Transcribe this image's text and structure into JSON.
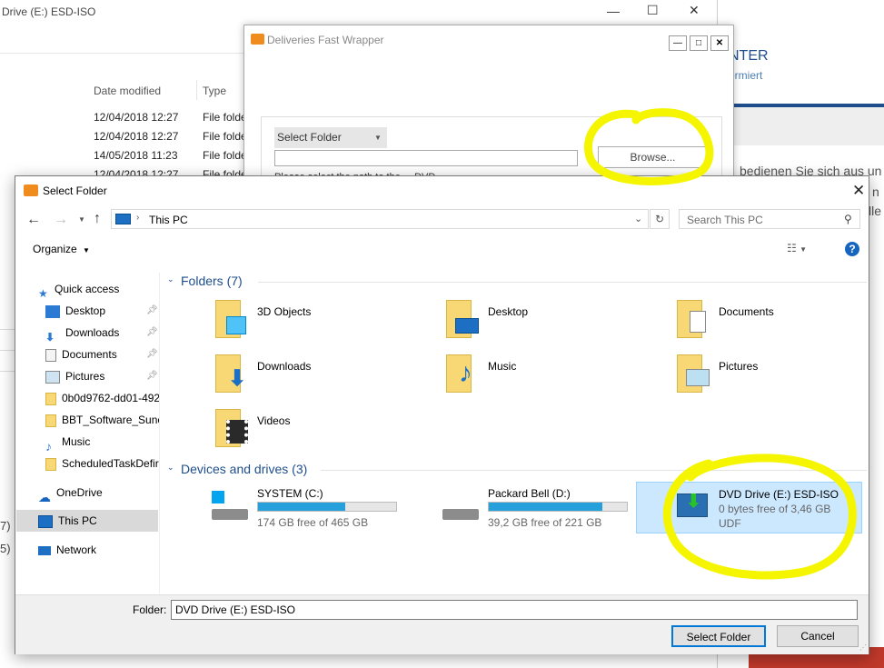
{
  "bg_explorer": {
    "title": "Drive (E:) ESD-ISO",
    "col_date": "Date modified",
    "col_type": "Type",
    "rows": [
      {
        "date": "12/04/2018 12:27",
        "type": "File folde"
      },
      {
        "date": "12/04/2018 12:27",
        "type": "File folde"
      },
      {
        "date": "14/05/2018 11:23",
        "type": "File folde"
      },
      {
        "date": "12/04/2018 12:27",
        "type": "File folde"
      }
    ],
    "left_frag1": "7)",
    "left_frag2": "5)"
  },
  "bg_web": {
    "heading": "NTER",
    "sub": "ormiert",
    "text1": "bedienen Sie sich aus un",
    "text2": "n",
    "text3": "lle"
  },
  "wrapper": {
    "title": "Deliveries Fast Wrapper",
    "select_label": "Select Folder",
    "browse_label": "Browse...",
    "hint": "Please select the path to the ... DVD"
  },
  "dialog": {
    "title": "Select Folder",
    "address": "This PC",
    "search_placeholder": "Search This PC",
    "organize": "Organize",
    "nav": {
      "quick_access": "Quick access",
      "items": [
        "Desktop",
        "Downloads",
        "Documents",
        "Pictures",
        "0b0d9762-dd01-492",
        "BBT_Software_Sune",
        "Music",
        "ScheduledTaskDefir"
      ],
      "onedrive": "OneDrive",
      "this_pc": "This PC",
      "network": "Network"
    },
    "folders_header": "Folders (7)",
    "folders": [
      "3D Objects",
      "Desktop",
      "Documents",
      "Downloads",
      "Music",
      "Pictures",
      "Videos"
    ],
    "devices_header": "Devices and drives (3)",
    "drives": [
      {
        "name": "SYSTEM (C:)",
        "free": "174 GB free of 465 GB",
        "used": 0.63
      },
      {
        "name": "Packard Bell (D:)",
        "free": "39,2 GB free of 221 GB",
        "used": 0.82
      },
      {
        "name": "DVD Drive (E:) ESD-ISO",
        "free": "0 bytes free of 3,46 GB",
        "fs": "UDF"
      }
    ],
    "folder_label": "Folder:",
    "folder_value": "DVD Drive (E:) ESD-ISO",
    "select_button": "Select Folder",
    "cancel_button": "Cancel"
  },
  "colors": {
    "highlight": "#f5f500",
    "accent": "#26a0da",
    "selected": "#cce8ff"
  }
}
